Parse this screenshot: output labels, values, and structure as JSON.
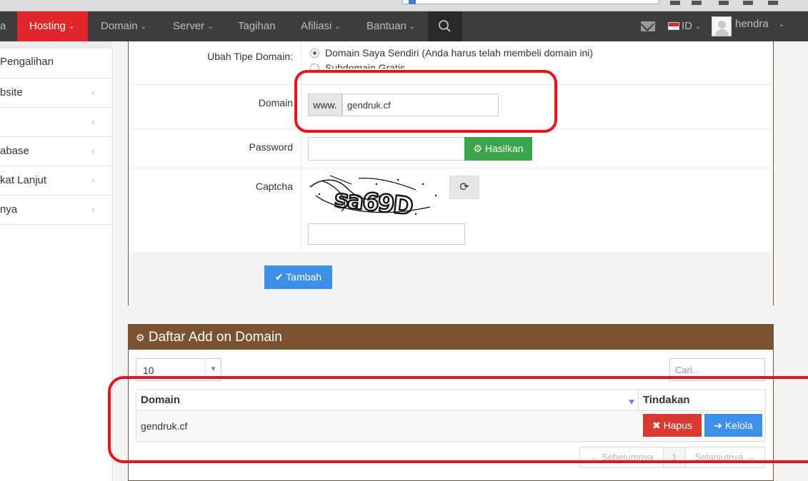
{
  "nav": {
    "items": [
      {
        "label": "a"
      },
      {
        "label": "Hosting"
      },
      {
        "label": "Domain"
      },
      {
        "label": "Server"
      },
      {
        "label": "Tagihan"
      },
      {
        "label": "Afiliasi"
      },
      {
        "label": "Bantuan"
      }
    ],
    "language": "ID",
    "user": "hendra"
  },
  "sidebar": {
    "items": [
      {
        "label": "Pengalihan"
      },
      {
        "label": "bsite"
      },
      {
        "label": ""
      },
      {
        "label": "abase"
      },
      {
        "label": "kat Lanjut"
      },
      {
        "label": "nya"
      }
    ]
  },
  "form": {
    "type_label": "Ubah Tipe Domain:",
    "type_option_own": "Domain Saya Sendiri (Anda harus telah membeli domain ini)",
    "type_option_sub": "Subdomain Gratis",
    "domain_label": "Domain",
    "domain_prefix": "www.",
    "domain_value": "gendruk.cf",
    "password_label": "Password",
    "password_value": "",
    "generate_button": "Hasilkan",
    "captcha_label": "Captcha",
    "captcha_text": "sa69D",
    "captcha_value": "",
    "submit_button": "Tambah"
  },
  "list": {
    "title": "Daftar Add on Domain",
    "page_size": "10",
    "search_placeholder": "Cari..",
    "columns": [
      "Domain",
      "Tindakan"
    ],
    "rows": [
      {
        "domain": "gendruk.cf",
        "delete_label": "Hapus",
        "manage_label": "Kelola"
      }
    ],
    "pager": {
      "prev": "← Sebelumnya",
      "page": "1",
      "next": "Selanjutnya →"
    }
  },
  "colors": {
    "navbar": "#3d3d3d",
    "nav_active": "#e0262b",
    "panel_brown": "#7b5230",
    "green_button": "#3aa54a",
    "blue_button": "#3d8fe8",
    "red_button": "#d83a33",
    "annotation": "#e8141c"
  }
}
